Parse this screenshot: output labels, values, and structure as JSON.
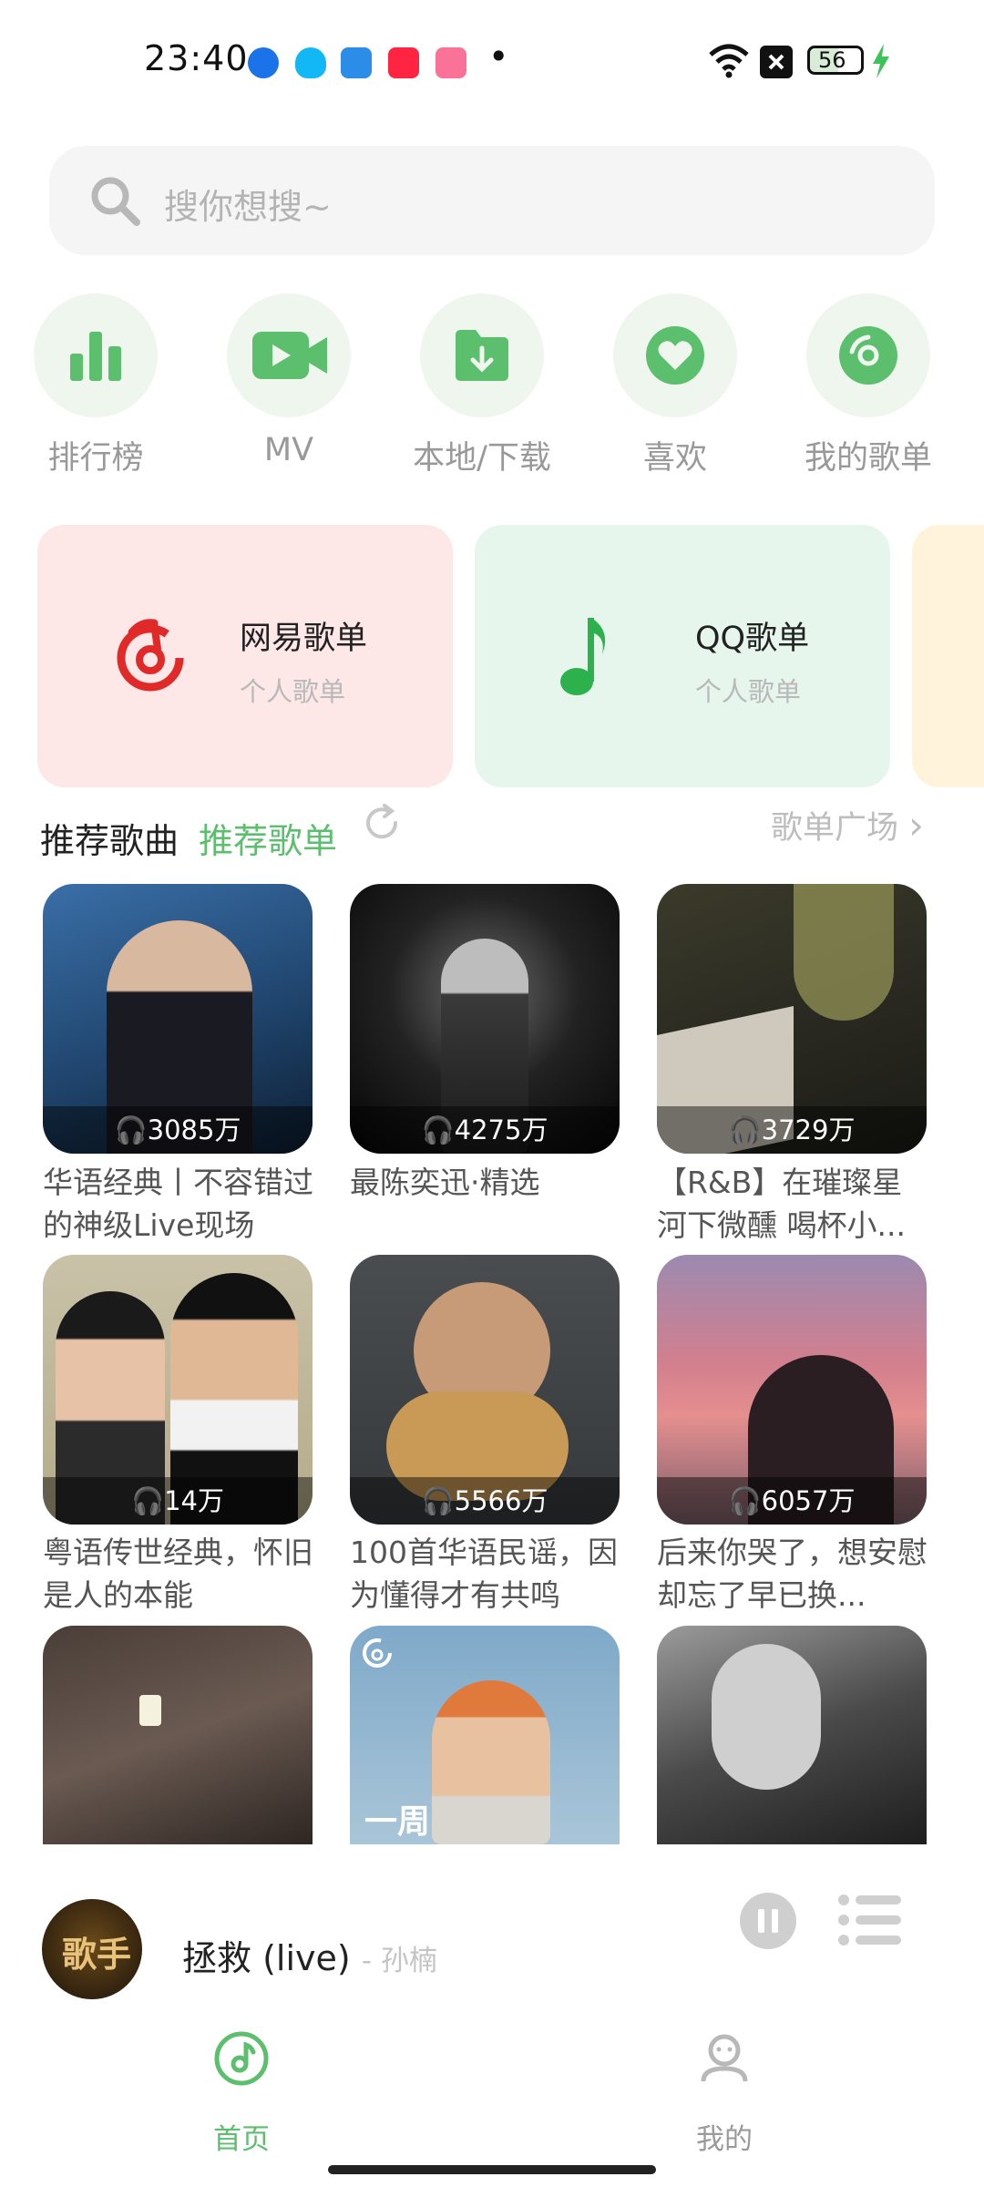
{
  "status_bar": {
    "time": "23:40",
    "battery": "56",
    "dot": "•"
  },
  "search": {
    "placeholder": "搜你想搜~"
  },
  "quick_nav": [
    {
      "label": "排行榜",
      "icon": "bar-chart-icon"
    },
    {
      "label": "MV",
      "icon": "video-camera-icon"
    },
    {
      "label": "本地/下载",
      "icon": "folder-download-icon"
    },
    {
      "label": "喜欢",
      "icon": "heart-icon"
    },
    {
      "label": "我的歌单",
      "icon": "disc-icon"
    }
  ],
  "source_cards": [
    {
      "title": "网易歌单",
      "subtitle": "个人歌单",
      "icon": "netease-logo-icon",
      "color": "#fde7e7"
    },
    {
      "title": "QQ歌单",
      "subtitle": "个人歌单",
      "icon": "music-note-icon",
      "color": "#e6f6ec"
    }
  ],
  "section": {
    "tab_songs": "推荐歌曲",
    "tab_playlists": "推荐歌单",
    "plaza": "歌单广场",
    "plaza_arrow": "›"
  },
  "playlists": [
    {
      "count": "3085万",
      "title": "华语经典丨不容错过的神级Live现场"
    },
    {
      "count": "4275万",
      "title": "最陈奕迅·精选"
    },
    {
      "count": "3729万",
      "title": "【R&B】在璀璨星河下微醺 喝杯小..."
    },
    {
      "count": "14万",
      "title": "粤语传世经典，怀旧是人的本能"
    },
    {
      "count": "5566万",
      "title": "100首华语民谣，因为懂得才有共鸣"
    },
    {
      "count": "6057万",
      "title": "后来你哭了，想安慰却忘了早已换..."
    },
    {
      "count": "",
      "title": ""
    },
    {
      "count": "",
      "title": "",
      "cover_text": "一周"
    },
    {
      "count": "",
      "title": ""
    }
  ],
  "player": {
    "song": "拯救 (live)",
    "artist": "- 孙楠",
    "avatar_text": "歌手"
  },
  "bottom_nav": [
    {
      "label": "首页",
      "icon": "music-disc-icon"
    },
    {
      "label": "我的",
      "icon": "user-icon"
    }
  ],
  "colors": {
    "accent": "#5cbf6e",
    "accent_light": "#eef6ee",
    "netease_red": "#e02a2a",
    "qq_green": "#2db14d"
  }
}
